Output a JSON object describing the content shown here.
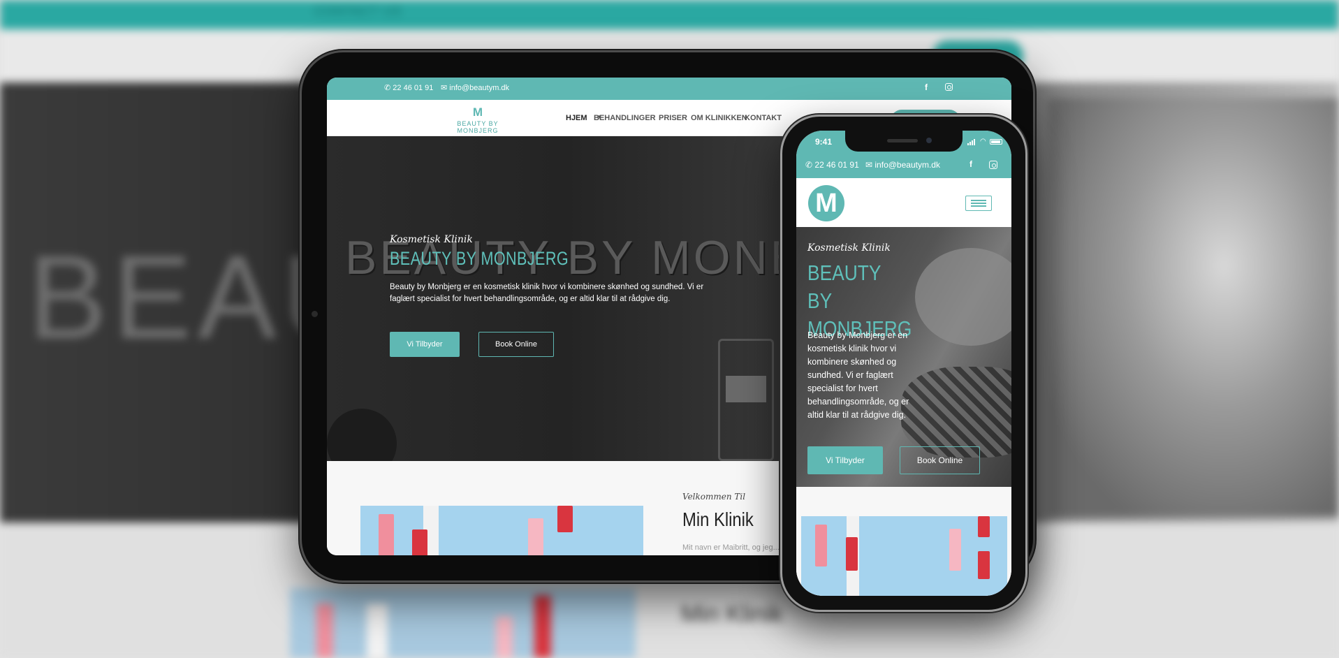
{
  "background": {
    "topbar_text": "CONTACT US",
    "hero_word": "BEAU",
    "section_heading": "Min Klinik"
  },
  "site": {
    "phone": "22 46 01 91",
    "email": "info@beautym.dk",
    "social": {
      "facebook_glyph": "f",
      "instagram_icon": "instagram-icon"
    },
    "logo_text": "BEAUTY BY MONBJERG",
    "logo_mark": "M",
    "nav": {
      "items": [
        "HJEM",
        "BEHANDLINGER",
        "PRISER",
        "OM KLINIKKEN",
        "KONTAKT"
      ],
      "active": "HJEM"
    },
    "hero": {
      "subtitle": "Kosmetisk Klinik",
      "title": "BEAUTY BY MONBJERG",
      "wall_sign": "BEAUTY BY MONBJERG",
      "description": "Beauty by Monbjerg er en kosmetisk klinik hvor vi kombinere skønhed og sundhed. Vi er faglært specialist for hvert behandlingsområde, og er altid klar til at rådgive dig.",
      "primary_button": "Vi Tilbyder",
      "secondary_button": "Book Online"
    },
    "welcome": {
      "kicker": "Velkommen Til",
      "heading": "Min Klinik",
      "body_start": "Mit navn er Maibritt, og jeg..."
    }
  },
  "phone_device": {
    "status_time": "9:41"
  },
  "colors": {
    "accent": "#5fb8b3",
    "hero_title": "#5fc0ba",
    "photo_bg": "#a5d3ee",
    "lipstick_red": "#d9353f",
    "lipstick_pink": "#f08f9d"
  }
}
